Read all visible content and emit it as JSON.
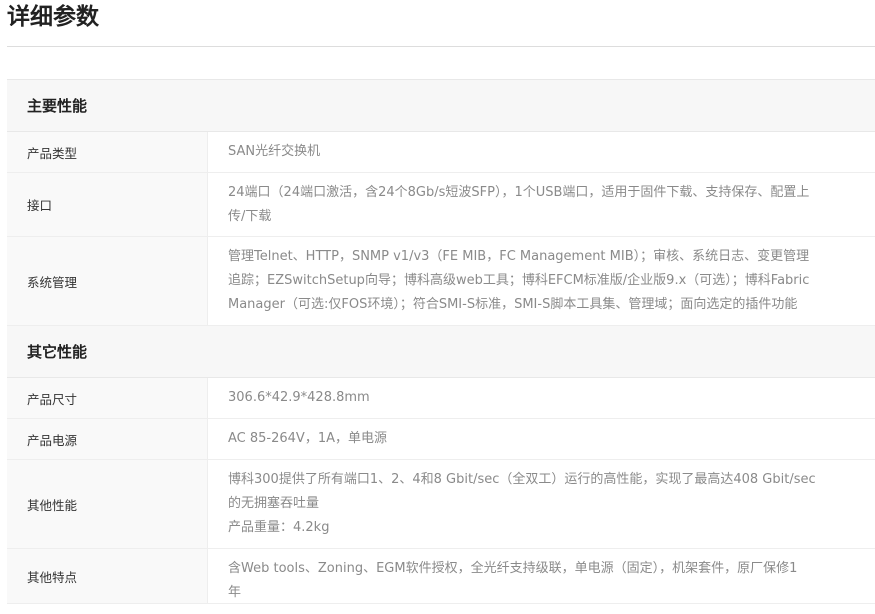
{
  "page": {
    "title": "详细参数"
  },
  "sections": [
    {
      "title": "主要性能",
      "rows": [
        {
          "label": "产品类型",
          "value_lines": [
            "SAN光纤交换机"
          ]
        },
        {
          "label": "接口",
          "value_lines": [
            "24端口（24端口激活，含24个8Gb/s短波SFP），1个USB端口，适用于固件下载、支持保存、配置上",
            "传/下载"
          ]
        },
        {
          "label": "系统管理",
          "value_lines": [
            "管理Telnet、HTTP，SNMP v1/v3（FE MIB，FC Management MIB）；审核、系统日志、变更管理",
            "追踪；EZSwitchSetup向导；博科高级web工具；博科EFCM标准版/企业版9.x（可选）；博科Fabric",
            "Manager（可选:仅FOS环境）；符合SMI-S标准，SMI-S脚本工具集、管理域；面向选定的插件功能"
          ]
        }
      ]
    },
    {
      "title": "其它性能",
      "rows": [
        {
          "label": "产品尺寸",
          "value_lines": [
            "306.6*42.9*428.8mm"
          ]
        },
        {
          "label": "产品电源",
          "value_lines": [
            "AC 85-264V，1A，单电源"
          ]
        },
        {
          "label": "其他性能",
          "value_lines": [
            "博科300提供了所有端口1、2、4和8 Gbit/sec（全双工）运行的高性能，实现了最高达408 Gbit/sec",
            "的无拥塞吞吐量",
            "产品重量：4.2kg"
          ]
        },
        {
          "label": "其他特点",
          "value_lines": [
            "含Web tools、Zoning、EGM软件授权，全光纤支持级联，单电源（固定），机架套件，原厂保修1",
            "年"
          ]
        }
      ]
    }
  ]
}
